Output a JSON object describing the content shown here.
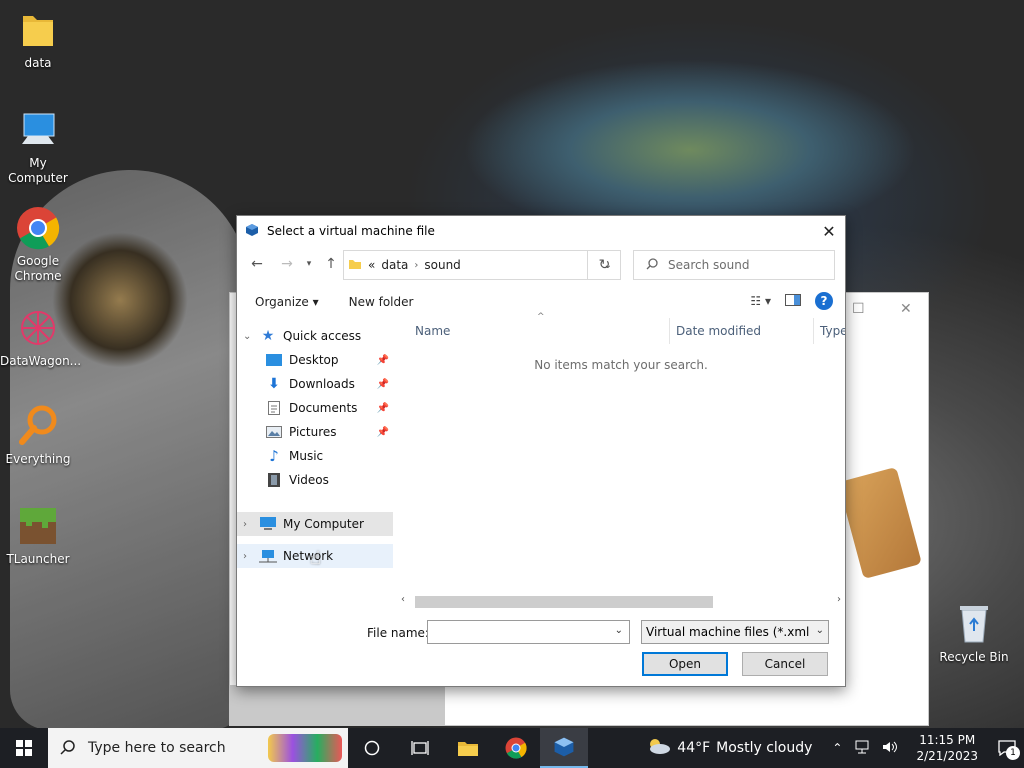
{
  "desktop": {
    "icons": [
      {
        "label": "data"
      },
      {
        "label": "My Computer"
      },
      {
        "label": "Google Chrome"
      },
      {
        "label": "DataWagon..."
      },
      {
        "label": "Everything"
      },
      {
        "label": "TLauncher"
      },
      {
        "label": "Recycle Bin"
      }
    ]
  },
  "dialog": {
    "title": "Select a virtual machine file",
    "address": {
      "prefix": "«",
      "segments": [
        "data",
        "sound"
      ]
    },
    "search_placeholder": "Search sound",
    "toolbar": {
      "organize": "Organize",
      "new_folder": "New folder",
      "help": "?"
    },
    "nav": {
      "quick_access": "Quick access",
      "items": [
        "Desktop",
        "Downloads",
        "Documents",
        "Pictures",
        "Music",
        "Videos"
      ],
      "my_computer": "My Computer",
      "network": "Network"
    },
    "columns": {
      "name": "Name",
      "date_modified": "Date modified",
      "type": "Type"
    },
    "empty_message": "No items match your search.",
    "file_name_label": "File name:",
    "file_name_value": "",
    "file_type": "Virtual machine files (*.xml *.vbox)",
    "open_label": "Open",
    "cancel_label": "Cancel"
  },
  "taskbar": {
    "search_placeholder": "Type here to search",
    "weather": {
      "temp": "44°F",
      "desc": "Mostly cloudy"
    },
    "time": "11:15 PM",
    "date": "2/21/2023",
    "notification_count": "1"
  },
  "colors": {
    "accent": "#0078d7",
    "taskbar": "#1d1f24",
    "selected": "#e5e5e5"
  }
}
